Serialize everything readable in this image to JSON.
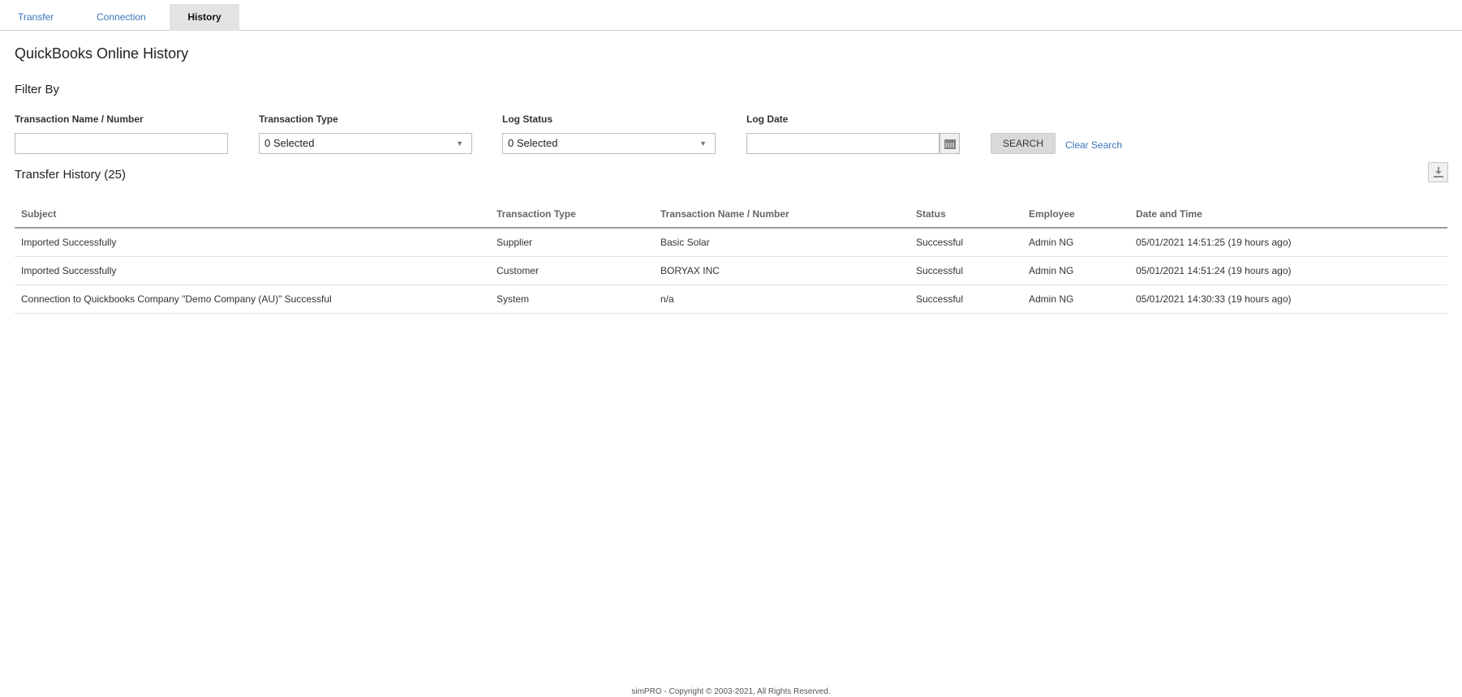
{
  "tabs": [
    {
      "label": "Transfer"
    },
    {
      "label": "Connection"
    },
    {
      "label": "History"
    }
  ],
  "page": {
    "title": "QuickBooks Online History"
  },
  "filter": {
    "title": "Filter By",
    "name_label": "Transaction Name / Number",
    "name_value": "",
    "type_label": "Transaction Type",
    "type_value": "0 Selected",
    "status_label": "Log Status",
    "status_value": "0 Selected",
    "date_label": "Log Date",
    "date_value": "",
    "search_label": "SEARCH",
    "clear_label": "Clear Search"
  },
  "history": {
    "title": "Transfer History (25)",
    "columns": [
      "Subject",
      "Transaction Type",
      "Transaction Name / Number",
      "Status",
      "Employee",
      "Date and Time"
    ],
    "rows": [
      {
        "subject": "Imported Successfully",
        "type": "Supplier",
        "name": "Basic Solar",
        "status": "Successful",
        "employee": "Admin NG",
        "datetime": "05/01/2021 14:51:25 (19 hours ago)"
      },
      {
        "subject": "Imported Successfully",
        "type": "Customer",
        "name": "BORYAX INC",
        "status": "Successful",
        "employee": "Admin NG",
        "datetime": "05/01/2021 14:51:24 (19 hours ago)"
      },
      {
        "subject": "Connection to Quickbooks Company \"Demo Company (AU)\" Successful",
        "type": "System",
        "name": "n/a",
        "status": "Successful",
        "employee": "Admin NG",
        "datetime": "05/01/2021 14:30:33 (19 hours ago)"
      }
    ]
  },
  "footer": {
    "text": "simPRO - Copyright © 2003-2021, All Rights Reserved."
  },
  "colors": {
    "link": "#3a74b8",
    "success": "#43a047",
    "active_tab": "#e3e3e3"
  },
  "icons": {
    "date_picker": "calendar-icon",
    "export": "download-icon",
    "select_caret": "caret-down-icon"
  }
}
